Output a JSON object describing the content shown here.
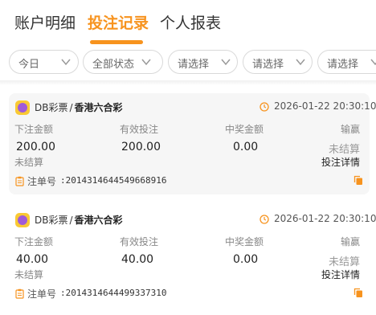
{
  "tabs": [
    {
      "label": "账户明细",
      "active": false
    },
    {
      "label": "投注记录",
      "active": true
    },
    {
      "label": "个人报表",
      "active": false
    }
  ],
  "colors": {
    "accent": "#f7931e",
    "card_bg": "#f6f6f6"
  },
  "filters": [
    {
      "label": "今日"
    },
    {
      "label": "全部状态"
    },
    {
      "label": "请选择"
    },
    {
      "label": "请选择"
    },
    {
      "label": "请选择"
    }
  ],
  "records": [
    {
      "vendor": "DB彩票",
      "separator": "/",
      "lottery": "香港六合彩",
      "time": "2026-01-22 20:30:10",
      "headers": {
        "bet_amount": "下注金额",
        "valid_bet": "有效投注",
        "win_amount": "中奖金额",
        "profit": "输赢"
      },
      "bet_amount": "200.00",
      "valid_bet": "200.00",
      "win_amount": "0.00",
      "profit_status": "未结算",
      "status": "未结算",
      "detail_label": "投注详情",
      "order_label": "注单号",
      "order_no": ":2014314644549668916",
      "icons": {
        "logo": "db-lottery-logo-icon",
        "time": "clock-icon",
        "order": "clipboard-icon",
        "copy": "copy-icon"
      }
    },
    {
      "vendor": "DB彩票",
      "separator": "/",
      "lottery": "香港六合彩",
      "time": "2026-01-22 20:30:10",
      "headers": {
        "bet_amount": "下注金额",
        "valid_bet": "有效投注",
        "win_amount": "中奖金额",
        "profit": "输赢"
      },
      "bet_amount": "40.00",
      "valid_bet": "40.00",
      "win_amount": "0.00",
      "profit_status": "未结算",
      "status": "未结算",
      "detail_label": "投注详情",
      "order_label": "注单号",
      "order_no": ":2014314644499337310",
      "icons": {
        "logo": "db-lottery-logo-icon",
        "time": "clock-icon",
        "order": "clipboard-icon",
        "copy": "copy-icon"
      }
    }
  ]
}
